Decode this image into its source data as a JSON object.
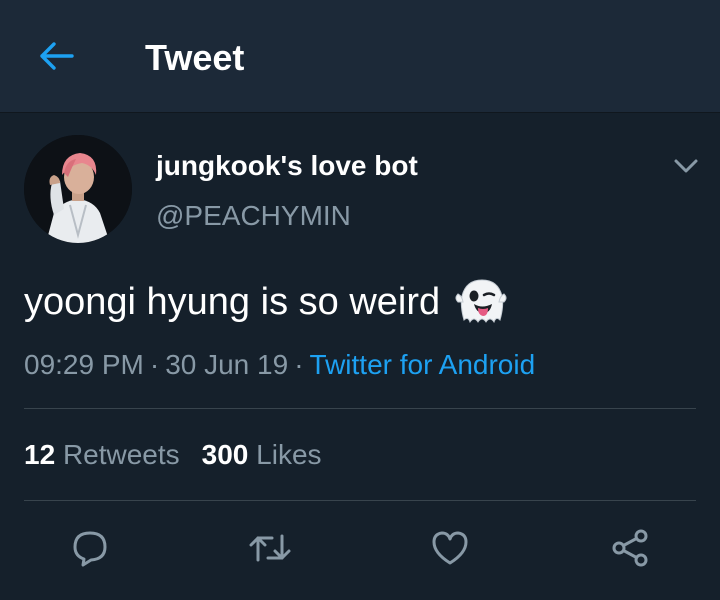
{
  "header": {
    "title": "Tweet",
    "back_icon": "arrow-left-icon"
  },
  "author": {
    "display_name": "jungkook's love bot",
    "handle": "@PEACHYMIN",
    "avatar": "profile-photo"
  },
  "tweet": {
    "text": "yoongi hyung is so weird",
    "emoji": "ghost-emoji"
  },
  "meta": {
    "time": "09:29 PM",
    "separator": "·",
    "date": "30 Jun 19",
    "source": "Twitter for Android"
  },
  "stats": {
    "retweets_count": "12",
    "retweets_label": "Retweets",
    "likes_count": "300",
    "likes_label": "Likes"
  },
  "actions": [
    "reply-icon",
    "retweet-icon",
    "like-icon",
    "share-icon"
  ],
  "colors": {
    "background": "#15202b",
    "header_bg": "#1c2938",
    "accent": "#1da1f2",
    "secondary_text": "#8899a6",
    "divider": "#38444d"
  }
}
